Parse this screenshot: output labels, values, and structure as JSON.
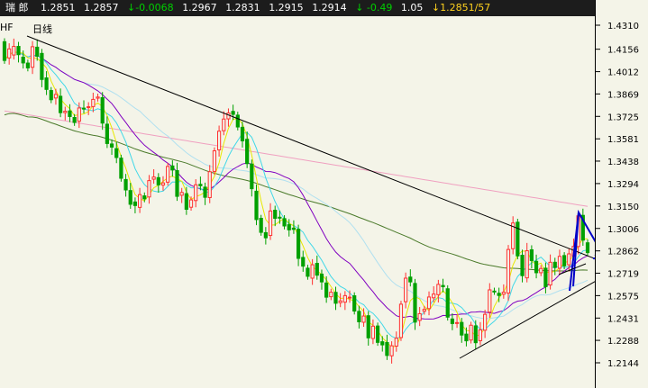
{
  "header": {
    "symbol": "瑞  郎",
    "open": "1.2851",
    "high": "1.2857",
    "change": "↓-0.0068",
    "v1": "1.2967",
    "v2": "1.2831",
    "v3": "1.2915",
    "v4": "1.2914",
    "pct": "↓ -0.49",
    "ratio": "1.05",
    "last": "↓1.2851/57"
  },
  "subtitle": {
    "left": "HF",
    "tf": "日线"
  },
  "colors": {
    "bg": "#f4f4e8",
    "up": "#ff3030",
    "down": "#00a000",
    "ma5": "#e8e800",
    "ma10": "#40d8e8",
    "ma20": "#8000c0",
    "ma60": "#b0e0f0",
    "ma120": "#4a7a2a",
    "ma250": "#f0a0c0",
    "arrow": "#0000c8"
  },
  "chart_data": {
    "type": "candlestick",
    "ylim": [
      1.2068,
      1.4396
    ],
    "y_ticks": [
      "1.4310",
      "1.4156",
      "1.4012",
      "1.3869",
      "1.3725",
      "1.3581",
      "1.3438",
      "1.3294",
      "1.3150",
      "1.3006",
      "1.2862",
      "1.2719",
      "1.2575",
      "1.2431",
      "1.2288",
      "1.2144"
    ],
    "close": [
      1.4084,
      1.4158,
      1.4174,
      1.4121,
      1.4068,
      1.4036,
      1.4172,
      1.4111,
      1.3962,
      1.3898,
      1.3832,
      1.3866,
      1.3749,
      1.3758,
      1.3724,
      1.3686,
      1.3779,
      1.3773,
      1.3787,
      1.3834,
      1.3849,
      1.3682,
      1.3551,
      1.3528,
      1.3461,
      1.3328,
      1.3253,
      1.3161,
      1.3153,
      1.3223,
      1.3196,
      1.3313,
      1.3336,
      1.3286,
      1.3298,
      1.3404,
      1.3381,
      1.3212,
      1.3237,
      1.3129,
      1.3189,
      1.3286,
      1.328,
      1.3206,
      1.337,
      1.3504,
      1.363,
      1.3708,
      1.3747,
      1.3738,
      1.3657,
      1.3568,
      1.3422,
      1.3261,
      1.3063,
      1.2981,
      1.2946,
      1.3118,
      1.3071,
      1.3072,
      1.3022,
      1.2997,
      1.3,
      1.2814,
      1.2764,
      1.2699,
      1.2773,
      1.2706,
      1.2663,
      1.2565,
      1.2597,
      1.2526,
      1.2541,
      1.2575,
      1.2565,
      1.2476,
      1.2407,
      1.2444,
      1.2304,
      1.2379,
      1.2275,
      1.2259,
      1.2191,
      1.2253,
      1.2302,
      1.252,
      1.2687,
      1.2663,
      1.2405,
      1.2459,
      1.2487,
      1.2566,
      1.2585,
      1.2647,
      1.2632,
      1.2437,
      1.2396,
      1.2402,
      1.2322,
      1.2285,
      1.2385,
      1.2273,
      1.2355,
      1.2455,
      1.2612,
      1.2602,
      1.2576,
      1.2597,
      1.2871,
      1.3041,
      1.283,
      1.2703,
      1.2863,
      1.28,
      1.2722,
      1.2749,
      1.2632,
      1.2789,
      1.2756,
      1.2827,
      1.2766,
      1.2843,
      1.2891,
      1.3087,
      1.2931,
      1.2851
    ],
    "open": [
      1.4204,
      1.41,
      1.4119,
      1.4174,
      1.4105,
      1.4067,
      1.404,
      1.4169,
      1.4129,
      1.3972,
      1.3891,
      1.3843,
      1.3854,
      1.3749,
      1.376,
      1.3718,
      1.3694,
      1.3778,
      1.3783,
      1.3788,
      1.3842,
      1.3845,
      1.3675,
      1.3548,
      1.3518,
      1.3457,
      1.332,
      1.3249,
      1.3176,
      1.3141,
      1.3215,
      1.3208,
      1.3322,
      1.3332,
      1.3284,
      1.3303,
      1.3407,
      1.3377,
      1.3219,
      1.3229,
      1.3142,
      1.3185,
      1.3289,
      1.3271,
      1.3204,
      1.3372,
      1.351,
      1.3633,
      1.3709,
      1.3757,
      1.3733,
      1.3655,
      1.3578,
      1.3419,
      1.3245,
      1.3071,
      1.2979,
      1.2961,
      1.3123,
      1.3078,
      1.3069,
      1.303,
      1.3008,
      1.3001,
      1.282,
      1.2751,
      1.2687,
      1.2782,
      1.2713,
      1.2656,
      1.2568,
      1.2596,
      1.253,
      1.2533,
      1.2565,
      1.2574,
      1.2474,
      1.2404,
      1.2446,
      1.23,
      1.238,
      1.2279,
      1.2274,
      1.2189,
      1.2251,
      1.2306,
      1.2536,
      1.2694,
      1.2653,
      1.2416,
      1.2475,
      1.2492,
      1.2561,
      1.2581,
      1.264,
      1.2619,
      1.2425,
      1.2397,
      1.2403,
      1.2328,
      1.229,
      1.2381,
      1.2286,
      1.2353,
      1.2469,
      1.2604,
      1.259,
      1.2584,
      1.2591,
      1.2876,
      1.3046,
      1.2834,
      1.2689,
      1.2869,
      1.2795,
      1.2722,
      1.2751,
      1.2643,
      1.2789,
      1.2751,
      1.2832,
      1.2773,
      1.2828,
      1.289,
      1.309,
      1.2914
    ]
  }
}
